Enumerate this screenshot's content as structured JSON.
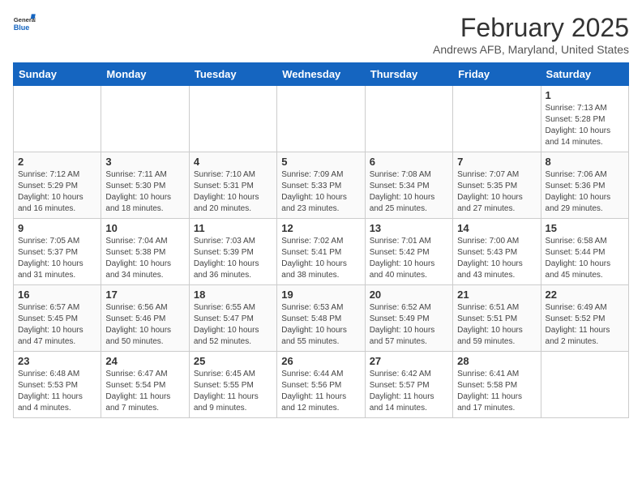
{
  "header": {
    "logo_general": "General",
    "logo_blue": "Blue",
    "title": "February 2025",
    "subtitle": "Andrews AFB, Maryland, United States"
  },
  "days_of_week": [
    "Sunday",
    "Monday",
    "Tuesday",
    "Wednesday",
    "Thursday",
    "Friday",
    "Saturday"
  ],
  "weeks": [
    [
      {
        "day": "",
        "info": ""
      },
      {
        "day": "",
        "info": ""
      },
      {
        "day": "",
        "info": ""
      },
      {
        "day": "",
        "info": ""
      },
      {
        "day": "",
        "info": ""
      },
      {
        "day": "",
        "info": ""
      },
      {
        "day": "1",
        "info": "Sunrise: 7:13 AM\nSunset: 5:28 PM\nDaylight: 10 hours\nand 14 minutes."
      }
    ],
    [
      {
        "day": "2",
        "info": "Sunrise: 7:12 AM\nSunset: 5:29 PM\nDaylight: 10 hours\nand 16 minutes."
      },
      {
        "day": "3",
        "info": "Sunrise: 7:11 AM\nSunset: 5:30 PM\nDaylight: 10 hours\nand 18 minutes."
      },
      {
        "day": "4",
        "info": "Sunrise: 7:10 AM\nSunset: 5:31 PM\nDaylight: 10 hours\nand 20 minutes."
      },
      {
        "day": "5",
        "info": "Sunrise: 7:09 AM\nSunset: 5:33 PM\nDaylight: 10 hours\nand 23 minutes."
      },
      {
        "day": "6",
        "info": "Sunrise: 7:08 AM\nSunset: 5:34 PM\nDaylight: 10 hours\nand 25 minutes."
      },
      {
        "day": "7",
        "info": "Sunrise: 7:07 AM\nSunset: 5:35 PM\nDaylight: 10 hours\nand 27 minutes."
      },
      {
        "day": "8",
        "info": "Sunrise: 7:06 AM\nSunset: 5:36 PM\nDaylight: 10 hours\nand 29 minutes."
      }
    ],
    [
      {
        "day": "9",
        "info": "Sunrise: 7:05 AM\nSunset: 5:37 PM\nDaylight: 10 hours\nand 31 minutes."
      },
      {
        "day": "10",
        "info": "Sunrise: 7:04 AM\nSunset: 5:38 PM\nDaylight: 10 hours\nand 34 minutes."
      },
      {
        "day": "11",
        "info": "Sunrise: 7:03 AM\nSunset: 5:39 PM\nDaylight: 10 hours\nand 36 minutes."
      },
      {
        "day": "12",
        "info": "Sunrise: 7:02 AM\nSunset: 5:41 PM\nDaylight: 10 hours\nand 38 minutes."
      },
      {
        "day": "13",
        "info": "Sunrise: 7:01 AM\nSunset: 5:42 PM\nDaylight: 10 hours\nand 40 minutes."
      },
      {
        "day": "14",
        "info": "Sunrise: 7:00 AM\nSunset: 5:43 PM\nDaylight: 10 hours\nand 43 minutes."
      },
      {
        "day": "15",
        "info": "Sunrise: 6:58 AM\nSunset: 5:44 PM\nDaylight: 10 hours\nand 45 minutes."
      }
    ],
    [
      {
        "day": "16",
        "info": "Sunrise: 6:57 AM\nSunset: 5:45 PM\nDaylight: 10 hours\nand 47 minutes."
      },
      {
        "day": "17",
        "info": "Sunrise: 6:56 AM\nSunset: 5:46 PM\nDaylight: 10 hours\nand 50 minutes."
      },
      {
        "day": "18",
        "info": "Sunrise: 6:55 AM\nSunset: 5:47 PM\nDaylight: 10 hours\nand 52 minutes."
      },
      {
        "day": "19",
        "info": "Sunrise: 6:53 AM\nSunset: 5:48 PM\nDaylight: 10 hours\nand 55 minutes."
      },
      {
        "day": "20",
        "info": "Sunrise: 6:52 AM\nSunset: 5:49 PM\nDaylight: 10 hours\nand 57 minutes."
      },
      {
        "day": "21",
        "info": "Sunrise: 6:51 AM\nSunset: 5:51 PM\nDaylight: 10 hours\nand 59 minutes."
      },
      {
        "day": "22",
        "info": "Sunrise: 6:49 AM\nSunset: 5:52 PM\nDaylight: 11 hours\nand 2 minutes."
      }
    ],
    [
      {
        "day": "23",
        "info": "Sunrise: 6:48 AM\nSunset: 5:53 PM\nDaylight: 11 hours\nand 4 minutes."
      },
      {
        "day": "24",
        "info": "Sunrise: 6:47 AM\nSunset: 5:54 PM\nDaylight: 11 hours\nand 7 minutes."
      },
      {
        "day": "25",
        "info": "Sunrise: 6:45 AM\nSunset: 5:55 PM\nDaylight: 11 hours\nand 9 minutes."
      },
      {
        "day": "26",
        "info": "Sunrise: 6:44 AM\nSunset: 5:56 PM\nDaylight: 11 hours\nand 12 minutes."
      },
      {
        "day": "27",
        "info": "Sunrise: 6:42 AM\nSunset: 5:57 PM\nDaylight: 11 hours\nand 14 minutes."
      },
      {
        "day": "28",
        "info": "Sunrise: 6:41 AM\nSunset: 5:58 PM\nDaylight: 11 hours\nand 17 minutes."
      },
      {
        "day": "",
        "info": ""
      }
    ]
  ]
}
